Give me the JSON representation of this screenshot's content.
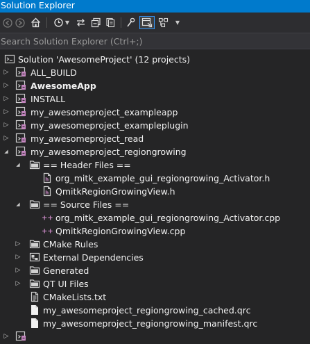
{
  "window": {
    "title": "Solution Explorer"
  },
  "search": {
    "placeholder": "Search Solution Explorer (Ctrl+;)"
  },
  "tree": [
    {
      "label": "Solution 'AwesomeProject' (12 projects)",
      "icon": "solution-icon",
      "expander": ""
    },
    {
      "label": "ALL_BUILD",
      "icon": "project-icon",
      "expander": "collapsed"
    },
    {
      "label": "AwesomeApp",
      "icon": "project-icon",
      "expander": "collapsed",
      "bold": true
    },
    {
      "label": "INSTALL",
      "icon": "project-icon",
      "expander": "collapsed"
    },
    {
      "label": "my_awesomeproject_exampleapp",
      "icon": "project-icon",
      "expander": "collapsed"
    },
    {
      "label": "my_awesomeproject_exampleplugin",
      "icon": "project-icon",
      "expander": "collapsed"
    },
    {
      "label": "my_awesomeproject_read",
      "icon": "project-icon",
      "expander": "collapsed"
    },
    {
      "label": "my_awesomeproject_regiongrowing",
      "icon": "project-icon",
      "expander": "expanded"
    },
    {
      "label": "== Header Files ==",
      "icon": "filter-icon",
      "expander": "expanded"
    },
    {
      "label": "org_mitk_example_gui_regiongrowing_Activator.h",
      "icon": "header-file-icon",
      "expander": ""
    },
    {
      "label": "QmitkRegionGrowingView.h",
      "icon": "header-file-icon",
      "expander": ""
    },
    {
      "label": "== Source Files ==",
      "icon": "filter-icon",
      "expander": "expanded"
    },
    {
      "label": "org_mitk_example_gui_regiongrowing_Activator.cpp",
      "icon": "cpp-file-icon",
      "expander": ""
    },
    {
      "label": "QmitkRegionGrowingView.cpp",
      "icon": "cpp-file-icon",
      "expander": ""
    },
    {
      "label": "CMake Rules",
      "icon": "filter-icon",
      "expander": "collapsed"
    },
    {
      "label": "External Dependencies",
      "icon": "dependencies-icon",
      "expander": "collapsed"
    },
    {
      "label": "Generated",
      "icon": "filter-icon",
      "expander": "collapsed"
    },
    {
      "label": "QT UI Files",
      "icon": "filter-icon",
      "expander": "collapsed"
    },
    {
      "label": "CMakeLists.txt",
      "icon": "text-file-icon",
      "expander": ""
    },
    {
      "label": "my_awesomeproject_regiongrowing_cached.qrc",
      "icon": "file-icon",
      "expander": ""
    },
    {
      "label": "my_awesomeproject_regiongrowing_manifest.qrc",
      "icon": "file-icon",
      "expander": ""
    },
    {
      "label": "",
      "icon": "project-icon",
      "expander": "collapsed"
    }
  ]
}
